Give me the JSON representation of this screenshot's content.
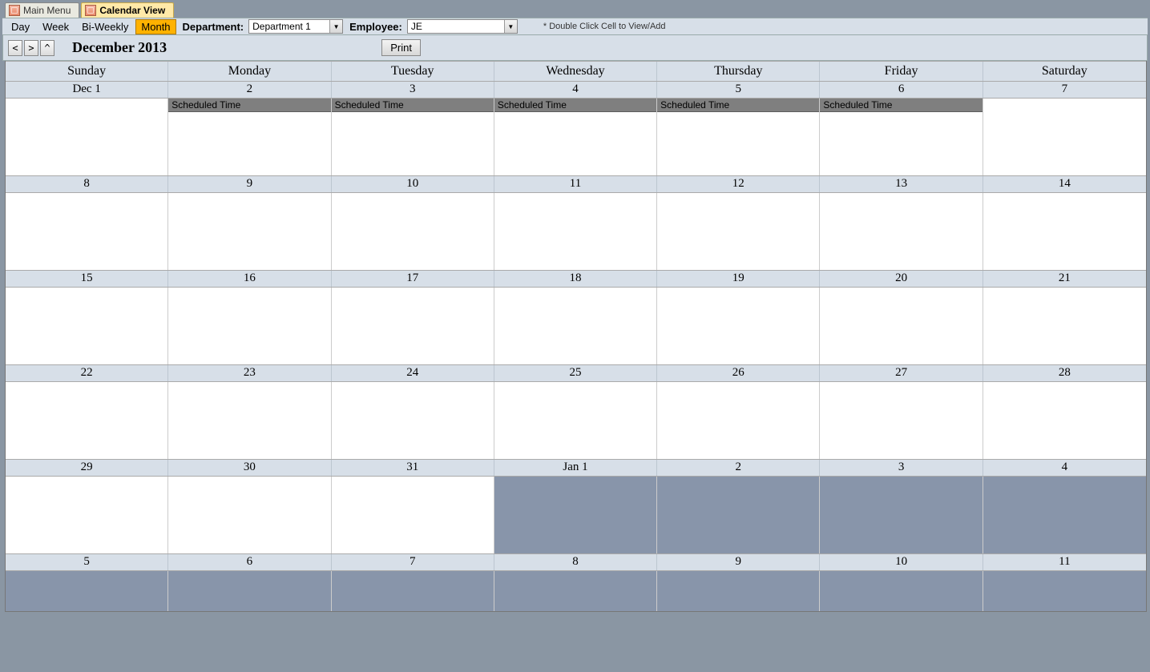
{
  "tabs": [
    {
      "label": "Main Menu",
      "active": false
    },
    {
      "label": "Calendar View",
      "active": true
    }
  ],
  "toolbar": {
    "views": {
      "day": "Day",
      "week": "Week",
      "biweekly": "Bi-Weekly",
      "month": "Month"
    },
    "active_view": "month",
    "department_label": "Department:",
    "department_value": "Department 1",
    "employee_label": "Employee:",
    "employee_value": "JE",
    "hint": "* Double Click Cell to View/Add"
  },
  "nav": {
    "prev": "<",
    "next": ">",
    "up": "^",
    "month_title": "December 2013",
    "print": "Print"
  },
  "weekdays": [
    "Sunday",
    "Monday",
    "Tuesday",
    "Wednesday",
    "Thursday",
    "Friday",
    "Saturday"
  ],
  "weeks": [
    {
      "short": false,
      "days": [
        {
          "label": "Dec 1",
          "out": false,
          "events": []
        },
        {
          "label": "2",
          "out": false,
          "events": [
            "Scheduled Time"
          ]
        },
        {
          "label": "3",
          "out": false,
          "events": [
            "Scheduled Time"
          ]
        },
        {
          "label": "4",
          "out": false,
          "events": [
            "Scheduled Time"
          ]
        },
        {
          "label": "5",
          "out": false,
          "events": [
            "Scheduled Time"
          ]
        },
        {
          "label": "6",
          "out": false,
          "events": [
            "Scheduled Time"
          ]
        },
        {
          "label": "7",
          "out": false,
          "events": []
        }
      ]
    },
    {
      "short": false,
      "days": [
        {
          "label": "8",
          "out": false,
          "events": []
        },
        {
          "label": "9",
          "out": false,
          "events": []
        },
        {
          "label": "10",
          "out": false,
          "events": []
        },
        {
          "label": "11",
          "out": false,
          "events": []
        },
        {
          "label": "12",
          "out": false,
          "events": []
        },
        {
          "label": "13",
          "out": false,
          "events": []
        },
        {
          "label": "14",
          "out": false,
          "events": []
        }
      ]
    },
    {
      "short": false,
      "days": [
        {
          "label": "15",
          "out": false,
          "events": []
        },
        {
          "label": "16",
          "out": false,
          "events": []
        },
        {
          "label": "17",
          "out": false,
          "events": []
        },
        {
          "label": "18",
          "out": false,
          "events": []
        },
        {
          "label": "19",
          "out": false,
          "events": []
        },
        {
          "label": "20",
          "out": false,
          "events": []
        },
        {
          "label": "21",
          "out": false,
          "events": []
        }
      ]
    },
    {
      "short": false,
      "days": [
        {
          "label": "22",
          "out": false,
          "events": []
        },
        {
          "label": "23",
          "out": false,
          "events": []
        },
        {
          "label": "24",
          "out": false,
          "events": []
        },
        {
          "label": "25",
          "out": false,
          "events": []
        },
        {
          "label": "26",
          "out": false,
          "events": []
        },
        {
          "label": "27",
          "out": false,
          "events": []
        },
        {
          "label": "28",
          "out": false,
          "events": []
        }
      ]
    },
    {
      "short": false,
      "days": [
        {
          "label": "29",
          "out": false,
          "events": []
        },
        {
          "label": "30",
          "out": false,
          "events": []
        },
        {
          "label": "31",
          "out": false,
          "events": []
        },
        {
          "label": "Jan 1",
          "out": true,
          "events": []
        },
        {
          "label": "2",
          "out": true,
          "events": []
        },
        {
          "label": "3",
          "out": true,
          "events": []
        },
        {
          "label": "4",
          "out": true,
          "events": []
        }
      ]
    },
    {
      "short": true,
      "days": [
        {
          "label": "5",
          "out": true,
          "events": []
        },
        {
          "label": "6",
          "out": true,
          "events": []
        },
        {
          "label": "7",
          "out": true,
          "events": []
        },
        {
          "label": "8",
          "out": true,
          "events": []
        },
        {
          "label": "9",
          "out": true,
          "events": []
        },
        {
          "label": "10",
          "out": true,
          "events": []
        },
        {
          "label": "11",
          "out": true,
          "events": []
        }
      ]
    }
  ]
}
